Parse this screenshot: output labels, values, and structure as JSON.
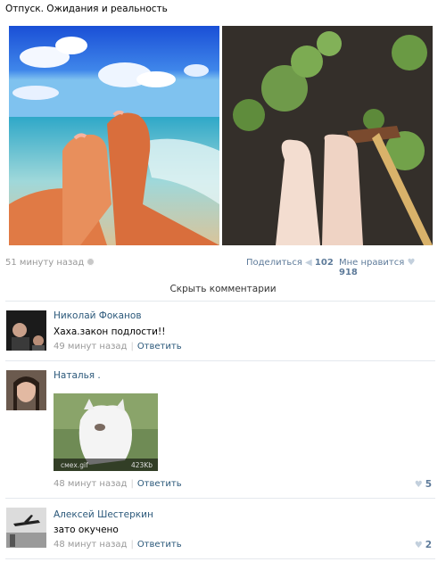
{
  "post": {
    "title": "Отпуск. Ожидания и реальность",
    "time": "51 минуту назад",
    "share_label": "Поделиться",
    "share_count": "102",
    "like_label": "Мне нравится",
    "like_count": "918"
  },
  "hide_comments": "Скрыть комментарии",
  "comments": [
    {
      "author": "Николай Фоканов",
      "text": "Хаха.закон подлости!!",
      "time": "49 минут назад",
      "reply": "Ответить",
      "likes": ""
    },
    {
      "author": "Наталья .",
      "text": "",
      "time": "48 минут назад",
      "reply": "Ответить",
      "likes": "5",
      "attachment": {
        "name": "смех.gif",
        "size": "423Kb"
      }
    },
    {
      "author": "Алексей Шестеркин",
      "text": "зато окучено",
      "time": "48 минут назад",
      "reply": "Ответить",
      "likes": "2"
    }
  ],
  "colors": {
    "link": "#2b587a",
    "muted": "#999999",
    "accent": "#5e7b9a",
    "divider": "#e4e8ed"
  },
  "icons": {
    "gear": "gear-icon",
    "share": "megaphone-icon",
    "like": "heart-icon"
  }
}
